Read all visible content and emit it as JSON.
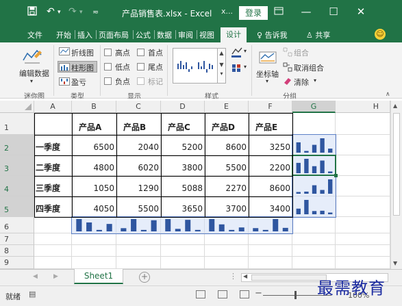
{
  "titlebar": {
    "title": "产品销售表.xlsx - Excel",
    "account_icon": "account-x-icon",
    "login_label": "登录",
    "bg_color": "#217346"
  },
  "tabs": [
    {
      "label": "文件"
    },
    {
      "label": "开始"
    },
    {
      "label": "插入"
    },
    {
      "label": "页面布局"
    },
    {
      "label": "公式"
    },
    {
      "label": "数据"
    },
    {
      "label": "审阅"
    },
    {
      "label": "视图"
    },
    {
      "label": "设计"
    }
  ],
  "tell_me": "告诉我",
  "share_label": "共享",
  "ribbon": {
    "edit_data": "编辑数据",
    "sparkline_group": "迷你图",
    "type_group": "类型",
    "type_line": "折线图",
    "type_column": "柱形图",
    "type_winloss": "盈亏",
    "show_group": "显示",
    "show_high": "高点",
    "show_first": "首点",
    "show_low": "低点",
    "show_last": "尾点",
    "show_negative": "负点",
    "show_markers": "标记",
    "style_group": "样式",
    "axis": "坐标轴",
    "group": "组合",
    "ungroup": "取消组合",
    "clear": "清除",
    "grouping_group": "分组"
  },
  "columns": [
    "A",
    "B",
    "C",
    "D",
    "E",
    "F",
    "G",
    "H"
  ],
  "rows": [
    "1",
    "2",
    "3",
    "4",
    "5",
    "6",
    "7",
    "8",
    "9"
  ],
  "table": {
    "headers": [
      "产品A",
      "产品B",
      "产品C",
      "产品D",
      "产品E"
    ],
    "records": [
      {
        "label": "一季度",
        "values": [
          6500,
          2040,
          5200,
          8600,
          3250
        ]
      },
      {
        "label": "二季度",
        "values": [
          4800,
          6020,
          3800,
          5500,
          2200
        ]
      },
      {
        "label": "三季度",
        "values": [
          1050,
          1290,
          5088,
          2270,
          8600
        ]
      },
      {
        "label": "四季度",
        "values": [
          4050,
          5500,
          3650,
          3700,
          3400
        ]
      }
    ]
  },
  "sparkline_color": "#2f56a0",
  "sheet_tab": "Sheet1",
  "status": "就绪",
  "zoom": "100%",
  "watermark": "最需教育"
}
